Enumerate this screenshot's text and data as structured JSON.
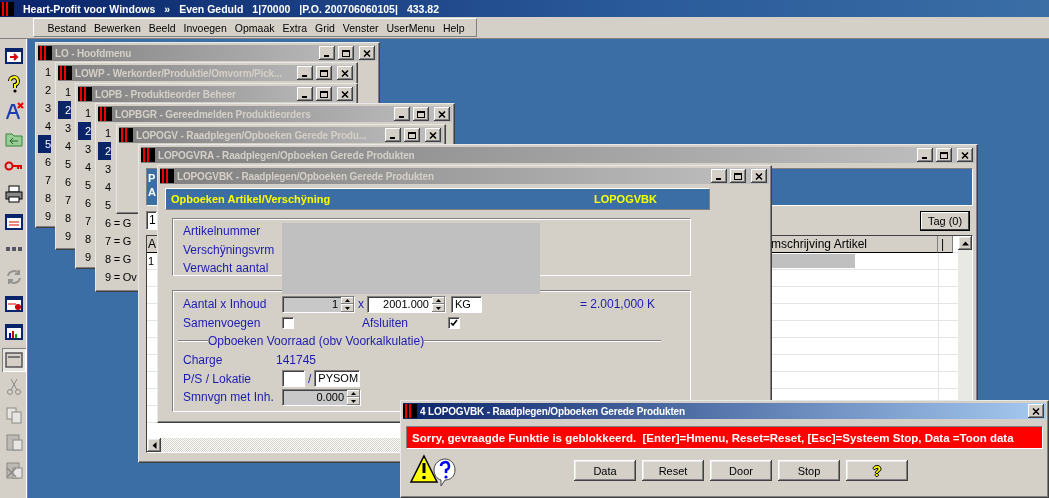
{
  "app_title": [
    "Heart-Profit voor Windows",
    "»",
    "Even Geduld",
    "1|70000",
    "|P.O. 200706060105|",
    "433.82"
  ],
  "menu": [
    "Bestand",
    "Bewerken",
    "Beeld",
    "Invoegen",
    "Opmaak",
    "Extra",
    "Grid",
    "Venster",
    "UserMenu",
    "Help"
  ],
  "toolbar": [
    {
      "disabled": false,
      "pressed": false
    },
    {
      "disabled": false,
      "pressed": false
    },
    {
      "disabled": false,
      "pressed": false
    },
    {
      "disabled": false,
      "pressed": false
    },
    {
      "disabled": false,
      "pressed": false
    },
    {
      "disabled": false,
      "pressed": false
    },
    {
      "disabled": false,
      "pressed": false
    },
    {
      "disabled": false,
      "pressed": false
    },
    {
      "disabled": true,
      "pressed": false
    },
    {
      "disabled": false,
      "pressed": false
    },
    {
      "disabled": false,
      "pressed": false
    },
    {
      "disabled": false,
      "pressed": true
    },
    {
      "disabled": true,
      "pressed": false
    },
    {
      "disabled": true,
      "pressed": false
    },
    {
      "disabled": true,
      "pressed": false
    },
    {
      "disabled": true,
      "pressed": false
    }
  ],
  "windows": [
    {
      "kind": "menu",
      "title": "LO - Hoofdmenu",
      "active": false,
      "items": [
        {
          "label": "1",
          "selected": false
        },
        {
          "label": "2",
          "selected": false
        },
        {
          "label": "3",
          "selected": false
        },
        {
          "label": "4",
          "selected": false
        },
        {
          "label": "5",
          "selected": true
        },
        {
          "label": "6",
          "selected": false
        },
        {
          "label": "7",
          "selected": false
        },
        {
          "label": "8",
          "selected": false
        },
        {
          "label": "9",
          "selected": false
        }
      ]
    },
    {
      "kind": "menu",
      "title": "LOWP - Werkorder/Produktie/Omvorm/Pick...",
      "active": false,
      "items": [
        {
          "label": "1",
          "selected": false
        },
        {
          "label": "2",
          "selected": true
        },
        {
          "label": "3",
          "selected": false
        },
        {
          "label": "4",
          "selected": false
        },
        {
          "label": "5",
          "selected": false
        },
        {
          "label": "6",
          "selected": false
        },
        {
          "label": "7",
          "selected": false
        },
        {
          "label": "8",
          "selected": false
        },
        {
          "label": "9",
          "selected": false
        }
      ]
    },
    {
      "kind": "menu",
      "title": "LOPB - Produktieorder Beheer",
      "active": false,
      "items": [
        {
          "label": "1",
          "selected": false
        },
        {
          "label": "2",
          "selected": true
        },
        {
          "label": "3",
          "selected": false
        },
        {
          "label": "4",
          "selected": false
        },
        {
          "label": "5",
          "selected": false
        },
        {
          "label": "6",
          "selected": false
        },
        {
          "label": "7",
          "selected": false
        },
        {
          "label": "8",
          "selected": false
        },
        {
          "label": "9",
          "selected": false
        }
      ]
    },
    {
      "kind": "menu",
      "title": "LOPBGR - Gereedmelden Produktieorders",
      "active": false,
      "items": [
        {
          "label": "1",
          "selected": false
        },
        {
          "label": "2",
          "selected": true
        },
        {
          "label": "3",
          "selected": false
        },
        {
          "label": "4",
          "selected": false
        },
        {
          "label": "5",
          "selected": false
        },
        {
          "label": "6 = G",
          "selected": false
        },
        {
          "label": "7 = G",
          "selected": false
        },
        {
          "label": "8 = G",
          "selected": false
        },
        {
          "label": "9 = Ov",
          "selected": false
        }
      ]
    },
    {
      "kind": "menu",
      "title": "LOPOGV - Raadplegen/Opboeken Gerede Produ...",
      "active": false
    },
    {
      "kind": "grid",
      "title": "LOPOGVRA - Raadplegen/Opboeken Gerede Produkten",
      "active": false,
      "header_lines": [
        "P",
        "A"
      ],
      "filter": "1",
      "tag_button": "Tag (0)",
      "columns": [
        "A",
        "mschrijving Artikel",
        "|"
      ],
      "rows": [
        {
          "cells": [
            "1"
          ],
          "redacted": true
        }
      ]
    },
    {
      "kind": "form",
      "title": "LOPOGVBK - Raadplegen/Opboeken Gerede Produkten",
      "active": false,
      "header": {
        "title": "Opboeken Artikel/Verschÿning",
        "code": "LOPOGVBK"
      },
      "info_labels": [
        "Artikelnummer",
        "Verschÿningsvrm",
        "Verwacht aantal"
      ],
      "info_redacted": true,
      "aantal": {
        "label": "Aantal x Inhoud",
        "count": {
          "value": "1",
          "disabled": true
        },
        "times": "x",
        "content": {
          "value": "2001.000",
          "disabled": false
        },
        "unit": "KG",
        "result": "= 2.001,000 K"
      },
      "samenvoegen": {
        "label": "Samenvoegen",
        "checked": false
      },
      "afsluiten": {
        "label": "Afsluiten",
        "checked": true
      },
      "voorraad": {
        "legend": "Opboeken Voorraad (obv Voorkalkulatie)",
        "charge_label": "Charge",
        "charge": "141745",
        "location_label": "P/S / Lokatie",
        "separator": "/",
        "location": "PYSOM",
        "smnvgn": {
          "label": "Smnvgn met Inh.",
          "value": "0.000",
          "disabled": true
        }
      }
    },
    {
      "kind": "message",
      "title": "4 LOPOGVBK - Raadplegen/Opboeken Gerede Produkten",
      "active": true,
      "message": "Sorry, gevraagde Funktie is geblokkeerd.  [Enter]=Hmenu, Reset=Reset, [Esc]=Systeem Stop, Data =Toon data",
      "buttons": [
        {
          "label": "Data",
          "kind": "text"
        },
        {
          "label": "Reset",
          "kind": "text"
        },
        {
          "label": "Door",
          "kind": "text"
        },
        {
          "label": "Stop",
          "kind": "text"
        },
        {
          "label": "?",
          "kind": "icon"
        }
      ]
    }
  ]
}
